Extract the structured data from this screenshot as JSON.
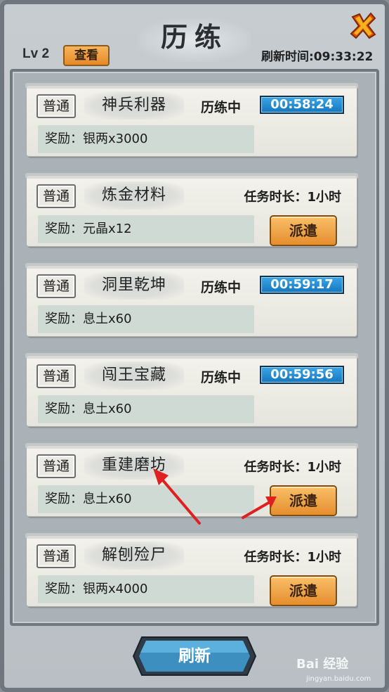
{
  "header": {
    "title": "历练",
    "level": "Lv 2",
    "view_label": "查看",
    "refresh_time": "刷新时间:09:33:22"
  },
  "tasks": [
    {
      "tag": "普通",
      "name": "神兵利器",
      "status": "历练中",
      "timer": "00:58:24",
      "reward": "奖励：银两x3000"
    },
    {
      "tag": "普通",
      "name": "炼金材料",
      "duration": "任务时长：1小时",
      "reward": "奖励：元晶x12",
      "button": "派遣"
    },
    {
      "tag": "普通",
      "name": "洞里乾坤",
      "status": "历练中",
      "timer": "00:59:17",
      "reward": "奖励：息土x60"
    },
    {
      "tag": "普通",
      "name": "闯王宝藏",
      "status": "历练中",
      "timer": "00:59:56",
      "reward": "奖励：息土x60"
    },
    {
      "tag": "普通",
      "name": "重建磨坊",
      "duration": "任务时长：1小时",
      "reward": "奖励：息土x60",
      "button": "派遣"
    },
    {
      "tag": "普通",
      "name": "解刨殓尸",
      "duration": "任务时长：1小时",
      "reward": "奖励：银两x4000",
      "button": "派遣"
    }
  ],
  "footer": {
    "refresh_label": "刷新",
    "watermark": "Bai 经验",
    "watermark_sub": "jingyan.baidu.com"
  },
  "colors": {
    "accent_orange": "#e58e2c",
    "timer_blue": "#1676bf",
    "arrow_red": "#e02020"
  },
  "icons": {
    "close": "close-x-icon",
    "annotation": "red-arrow-icon"
  }
}
